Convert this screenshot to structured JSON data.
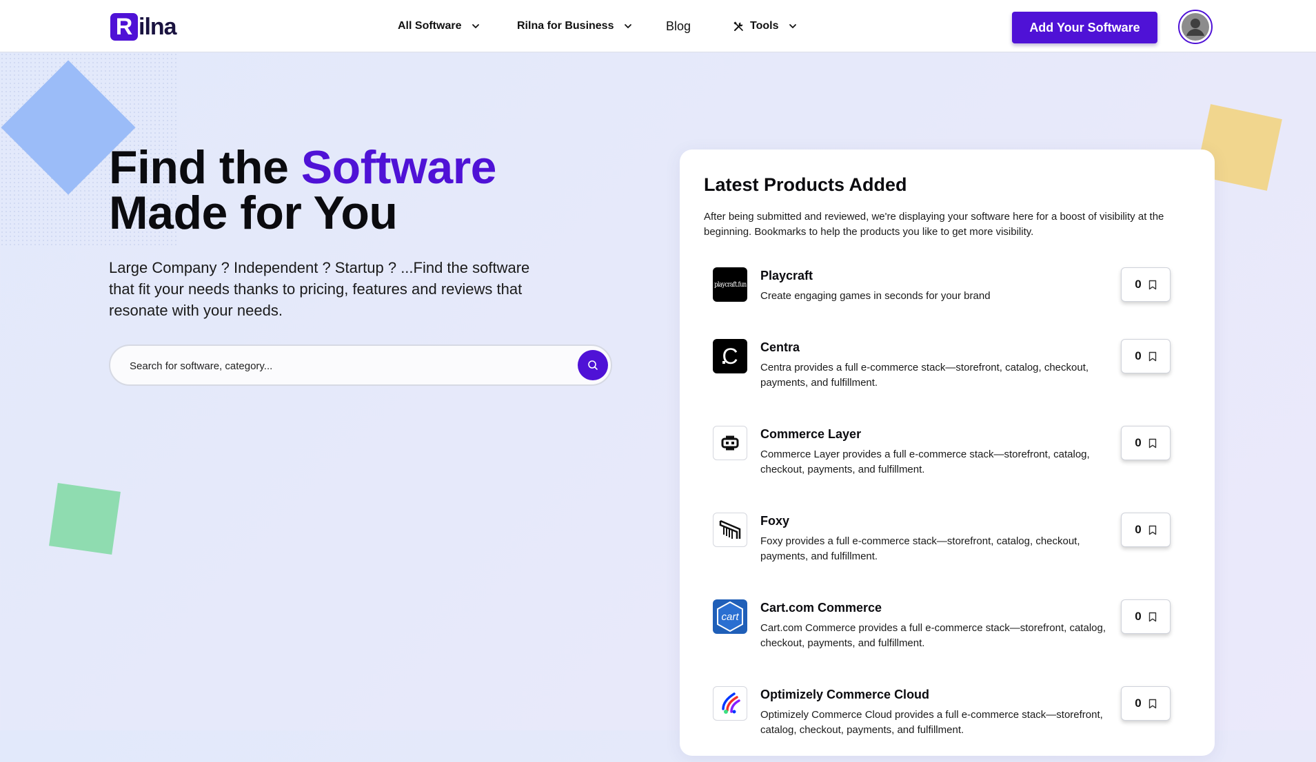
{
  "brand": {
    "logo_letter": "R",
    "logo_rest": "ilna",
    "accent": "#4f12d6"
  },
  "nav": {
    "all_software": "All Software",
    "business": "Rilna for Business",
    "blog": "Blog",
    "tools": "Tools",
    "add_button": "Add Your Software"
  },
  "hero": {
    "title_part1": "Find the ",
    "title_accent": "Software",
    "title_line2": "Made for You",
    "subtitle": "Large Company ? Independent ? Startup ? ...Find the software that fit your needs thanks to pricing, features and reviews that resonate with your needs.",
    "search_placeholder": "Search for software, category..."
  },
  "latest": {
    "title": "Latest Products Added",
    "description": "After being submitted and reviewed, we're displaying your software here for a boost of visibility at the beginning. Bookmarks to help the products you like to get more visibility.",
    "products": [
      {
        "name": "Playcraft",
        "description": "Create engaging games in seconds for your brand",
        "bookmarks": "0",
        "logo_text": "playcraft.fun"
      },
      {
        "name": "Centra",
        "description": "Centra provides a full e-commerce stack—storefront, catalog, checkout, payments, and fulfillment.",
        "bookmarks": "0",
        "logo_text": "C"
      },
      {
        "name": "Commerce Layer",
        "description": "Commerce Layer provides a full e-commerce stack—storefront, catalog, checkout, payments, and fulfillment.",
        "bookmarks": "0"
      },
      {
        "name": "Foxy",
        "description": "Foxy provides a full e-commerce stack—storefront, catalog, checkout, payments, and fulfillment.",
        "bookmarks": "0"
      },
      {
        "name": "Cart.com Commerce",
        "description": "Cart.com Commerce provides a full e-commerce stack—storefront, catalog, checkout, payments, and fulfillment.",
        "bookmarks": "0",
        "logo_text": "cart"
      },
      {
        "name": "Optimizely Commerce Cloud",
        "description": "Optimizely Commerce Cloud provides a full e-commerce stack—storefront, catalog, checkout, payments, and fulfillment.",
        "bookmarks": "0"
      }
    ]
  },
  "decorations": {
    "blue_diamond": "#9bbcf8",
    "yellow_square": "#f1d68e",
    "green_square": "#8fdcb0"
  }
}
